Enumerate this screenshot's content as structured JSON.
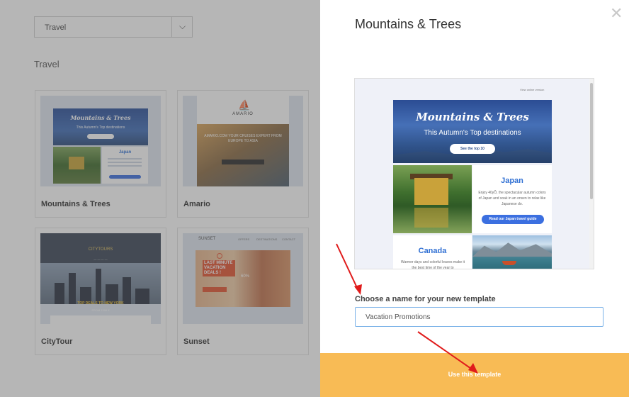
{
  "gallery": {
    "category_select": {
      "value": "Travel"
    },
    "section_title": "Travel",
    "templates": [
      {
        "label": "Mountains & Trees",
        "thumb_title": "Mountains & Trees",
        "thumb_subtitle": "This Autumn's Top destinations",
        "thumb_heading": "Japan"
      },
      {
        "label": "Amario",
        "thumb_brand": "AMARIO",
        "thumb_text": "AMARIO.COM YOUR CRUISES EXPERT FROM EUROPE TO ASIA"
      },
      {
        "label": "CityTour",
        "thumb_logo": "CITYTOURS",
        "thumb_deal": "TOP DEALS TO NEW YORK",
        "thumb_price": "FROM 1399 €"
      },
      {
        "label": "Sunset",
        "thumb_brand": "SUNSET",
        "thumb_headline": "LAST MINUTE VACATION DEALS !",
        "thumb_pct": "60%"
      }
    ]
  },
  "modal": {
    "title": "Mountains & Trees",
    "preview": {
      "online_link": "View online version",
      "hero_title": "Mountains & Trees",
      "hero_subtitle": "This Autumn's Top destinations",
      "hero_button": "See the top 10",
      "section1_title": "Japan",
      "section1_text": "Enjoy 40yÕ, the spectacular autumn colors of Japan and soak in an onsen to relax like Japanese do.",
      "section1_button": "Read our Japan travel guide",
      "section2_title": "Canada",
      "section2_text": "Warmer days and colorful leaves make it the best time of the year to"
    },
    "name_label": "Choose a name for your new template",
    "name_input_value": "Vacation Promotions",
    "use_button": "Use this template"
  },
  "colors": {
    "cta": "#f8bb55",
    "accent_blue": "#3b6fe0",
    "input_border": "#7ab2e8",
    "annotation_arrow": "#e01b1b"
  }
}
